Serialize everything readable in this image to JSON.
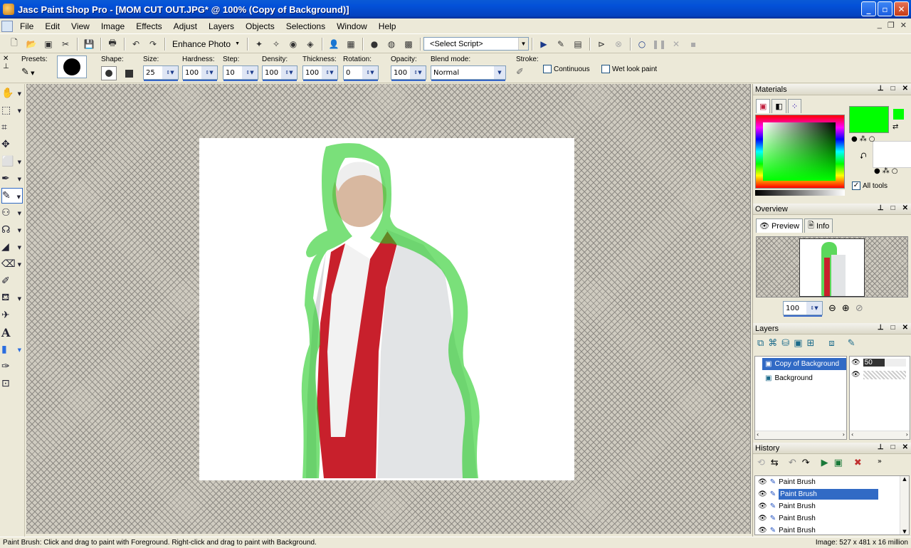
{
  "window": {
    "title": "Jasc Paint Shop Pro - [MOM CUT OUT.JPG* @ 100% (Copy of Background)]",
    "buttons": {
      "minimize": "_",
      "maximize": "▫",
      "close": "✕"
    }
  },
  "menu": [
    "File",
    "Edit",
    "View",
    "Image",
    "Effects",
    "Adjust",
    "Layers",
    "Objects",
    "Selections",
    "Window",
    "Help"
  ],
  "toolbar1": {
    "enhance_photo_label": "Enhance Photo",
    "script_select_value": "<Select Script>"
  },
  "tool_options": {
    "presets_label": "Presets:",
    "shape_label": "Shape:",
    "size_label": "Size:",
    "size_value": "25",
    "hardness_label": "Hardness:",
    "hardness_value": "100",
    "step_label": "Step:",
    "step_value": "10",
    "density_label": "Density:",
    "density_value": "100",
    "thickness_label": "Thickness:",
    "thickness_value": "100",
    "rotation_label": "Rotation:",
    "rotation_value": "0",
    "opacity_label": "Opacity:",
    "opacity_value": "100",
    "blend_mode_label": "Blend mode:",
    "blend_mode_value": "Normal",
    "stroke_label": "Stroke:",
    "continuous_label": "Continuous",
    "wet_look_label": "Wet look paint"
  },
  "materials": {
    "title": "Materials",
    "foreground_color": "#00ff00",
    "all_tools_label": "All tools",
    "all_tools_checked": true
  },
  "overview": {
    "title": "Overview",
    "tab_preview": "Preview",
    "tab_info": "Info",
    "zoom_value": "100"
  },
  "layers": {
    "title": "Layers",
    "items": [
      {
        "name": "Copy of Background",
        "opacity": "50",
        "selected": true
      },
      {
        "name": "Background",
        "opacity": "",
        "selected": false
      }
    ]
  },
  "history": {
    "title": "History",
    "items": [
      {
        "label": "Paint Brush",
        "selected": false
      },
      {
        "label": "Paint Brush",
        "selected": true
      },
      {
        "label": "Paint Brush",
        "selected": false
      },
      {
        "label": "Paint Brush",
        "selected": false
      },
      {
        "label": "Paint Brush",
        "selected": false
      }
    ]
  },
  "status": {
    "hint": "Paint Brush: Click and drag to paint with Foreground. Right-click and drag to paint with Background.",
    "image_info": "Image:  527 x 481 x 16 million"
  }
}
